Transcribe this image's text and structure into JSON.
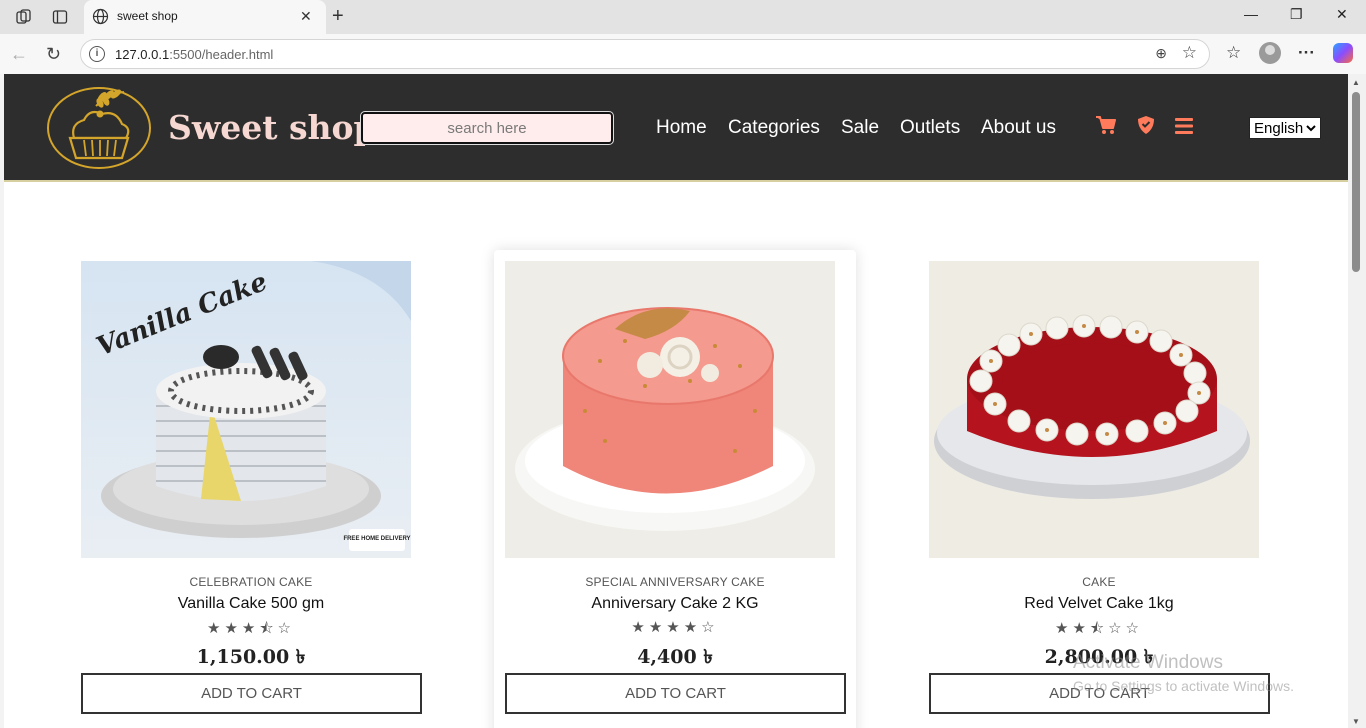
{
  "browser": {
    "tab_title": "sweet shop",
    "new_tab": "+",
    "url_host": "127.0.0.1",
    "url_rest": ":5500/header.html",
    "icons": [
      "workspaces-icon",
      "tab-actions-icon",
      "globe-icon",
      "close-icon",
      "back-icon",
      "refresh-icon",
      "info-icon",
      "zoom-icon",
      "favorite-star-icon",
      "favorites-icon",
      "profile-icon",
      "more-icon",
      "copilot-icon",
      "minimize-icon",
      "restore-icon",
      "close-window-icon"
    ]
  },
  "header": {
    "brand": "Sweet shop",
    "search_placeholder": "search here",
    "menu": [
      "Home",
      "Categories",
      "Sale",
      "Outlets",
      "About us"
    ],
    "icons": [
      "cart-icon",
      "shield-icon",
      "hamburger-menu-icon"
    ],
    "accent_color": "#ff7b5c",
    "background_color": "#2d2d2d",
    "language": "English"
  },
  "products": [
    {
      "category": "CELEBRATION CAKE",
      "name": "Vanilla Cake 500 gm",
      "rating": 3.5,
      "stars": "★★★⯪☆",
      "price": "1,150.00 ৳",
      "button": "ADD TO CART",
      "image_label": "Vanilla Cake",
      "badge": "FREE HOME DELIVERY"
    },
    {
      "category": "SPECIAL ANNIVERSARY CAKE",
      "name": "Anniversary Cake 2 KG",
      "rating": 4,
      "stars": "★★★★☆",
      "price": "4,400 ৳",
      "button": "ADD TO CART"
    },
    {
      "category": "CAKE",
      "name": "Red Velvet Cake 1kg",
      "rating": 2.5,
      "stars": "★★⯪☆☆",
      "price": "2,800.00 ৳",
      "button": "ADD TO CART"
    }
  ],
  "watermark": {
    "line1": "Activate Windows",
    "line2": "Go to Settings to activate Windows."
  }
}
